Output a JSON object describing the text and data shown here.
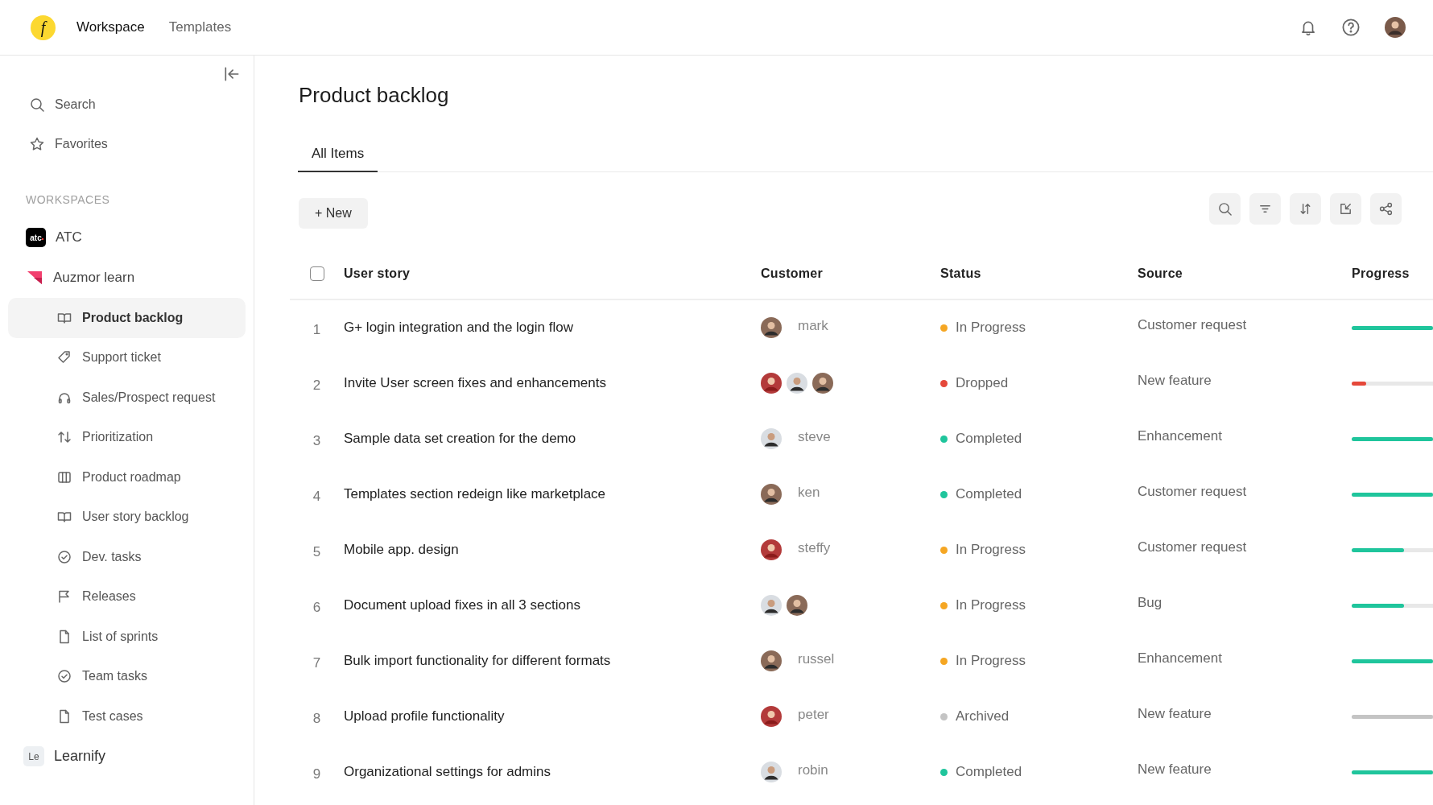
{
  "header": {
    "logo": "f",
    "nav": [
      {
        "label": "Workspace",
        "selected": true
      },
      {
        "label": "Templates",
        "selected": false
      }
    ]
  },
  "sidebar": {
    "top": [
      {
        "kind": "search",
        "label": "Search"
      },
      {
        "kind": "favorites",
        "label": "Favorites"
      }
    ],
    "section": "WORKSPACES",
    "workspaces": [
      {
        "kind": "atc",
        "badge": "atc",
        "label": "ATC"
      },
      {
        "kind": "auzmor",
        "label": "Auzmor learn",
        "children": [
          {
            "kind": "book",
            "label": "Product backlog",
            "selected": true
          },
          {
            "kind": "tag",
            "label": "Support ticket",
            "selected": false
          },
          {
            "kind": "headset",
            "label": "Sales/Prospect request",
            "selected": false
          },
          {
            "kind": "sort",
            "label": "Prioritization",
            "selected": false
          },
          {
            "kind": "columns",
            "label": "Product roadmap",
            "selected": false
          },
          {
            "kind": "book",
            "label": "User story backlog",
            "selected": false
          },
          {
            "kind": "check",
            "label": "Dev. tasks",
            "selected": false
          },
          {
            "kind": "flag",
            "label": "Releases",
            "selected": false
          },
          {
            "kind": "file",
            "label": "List of sprints",
            "selected": false
          },
          {
            "kind": "check",
            "label": "Team tasks",
            "selected": false
          },
          {
            "kind": "file",
            "label": "Test cases",
            "selected": false
          }
        ]
      },
      {
        "kind": "letters",
        "badge": "Le",
        "label": "Learnify"
      }
    ]
  },
  "page": {
    "title": "Product backlog",
    "tabs": [
      {
        "label": "All Items",
        "selected": true
      }
    ],
    "new_button": "+ New"
  },
  "table": {
    "select_all": {
      "checked": false
    },
    "columns": [
      "User story",
      "Customer",
      "Status",
      "Source",
      "Progress"
    ],
    "rows": [
      {
        "number": "1",
        "story": "G+ login integration and the login flow",
        "customer": {
          "name": "mark",
          "people": [
            {
              "kind": "avatar"
            }
          ]
        },
        "status": {
          "label": "In Progress",
          "color": "#f5a623"
        },
        "source": "Customer request",
        "progress": {
          "level": 1,
          "color": "#1fc59c"
        }
      },
      {
        "number": "2",
        "story": "Invite User screen fixes and enhancements",
        "customer": {
          "people": [
            {
              "kind": "avatar"
            },
            {
              "kind": "avatar"
            },
            {
              "kind": "avatar"
            }
          ]
        },
        "status": {
          "label": "Dropped",
          "color": "#e5483a"
        },
        "source": "New feature",
        "progress": {
          "level": 0.18,
          "color": "#e5483a"
        }
      },
      {
        "number": "3",
        "story": "Sample data set creation for the demo",
        "customer": {
          "name": "steve",
          "people": [
            {
              "kind": "avatar"
            }
          ]
        },
        "status": {
          "label": "Completed",
          "color": "#1fc59c"
        },
        "source": "Enhancement",
        "progress": {
          "level": 1,
          "color": "#1fc59c"
        }
      },
      {
        "number": "4",
        "story": "Templates section redeign like marketplace",
        "customer": {
          "name": "ken",
          "people": [
            {
              "kind": "avatar"
            }
          ]
        },
        "status": {
          "label": "Completed",
          "color": "#1fc59c"
        },
        "source": "Customer request",
        "progress": {
          "level": 1,
          "color": "#1fc59c"
        }
      },
      {
        "number": "5",
        "story": "Mobile app. design",
        "customer": {
          "name": "steffy",
          "people": [
            {
              "kind": "avatar"
            }
          ]
        },
        "status": {
          "label": "In Progress",
          "color": "#f5a623"
        },
        "source": "Customer request",
        "progress": {
          "level": 0.64,
          "color": "#1fc59c"
        }
      },
      {
        "number": "6",
        "story": "Document upload fixes in all 3 sections",
        "customer": {
          "people": [
            {
              "kind": "avatar"
            },
            {
              "kind": "avatar"
            }
          ]
        },
        "status": {
          "label": "In Progress",
          "color": "#f5a623"
        },
        "source": "Bug",
        "progress": {
          "level": 0.64,
          "color": "#1fc59c"
        }
      },
      {
        "number": "7",
        "story": "Bulk import functionality for different formats",
        "customer": {
          "name": "russel",
          "people": [
            {
              "kind": "avatar"
            }
          ]
        },
        "status": {
          "label": "In Progress",
          "color": "#f5a623"
        },
        "source": "Enhancement",
        "progress": {
          "level": 1,
          "color": "#1fc59c"
        }
      },
      {
        "number": "8",
        "story": "Upload profile functionality",
        "customer": {
          "name": "peter",
          "people": [
            {
              "kind": "avatar"
            }
          ]
        },
        "status": {
          "label": "Archived",
          "color": "#c4c4c4"
        },
        "source": "New feature",
        "progress": {
          "level": 1,
          "color": "#c4c4c4"
        }
      },
      {
        "number": "9",
        "story": "Organizational settings for admins",
        "customer": {
          "name": "robin",
          "people": [
            {
              "kind": "avatar"
            }
          ]
        },
        "status": {
          "label": "Completed",
          "color": "#1fc59c"
        },
        "source": "New feature",
        "progress": {
          "level": 1,
          "color": "#1fc59c"
        }
      }
    ]
  }
}
